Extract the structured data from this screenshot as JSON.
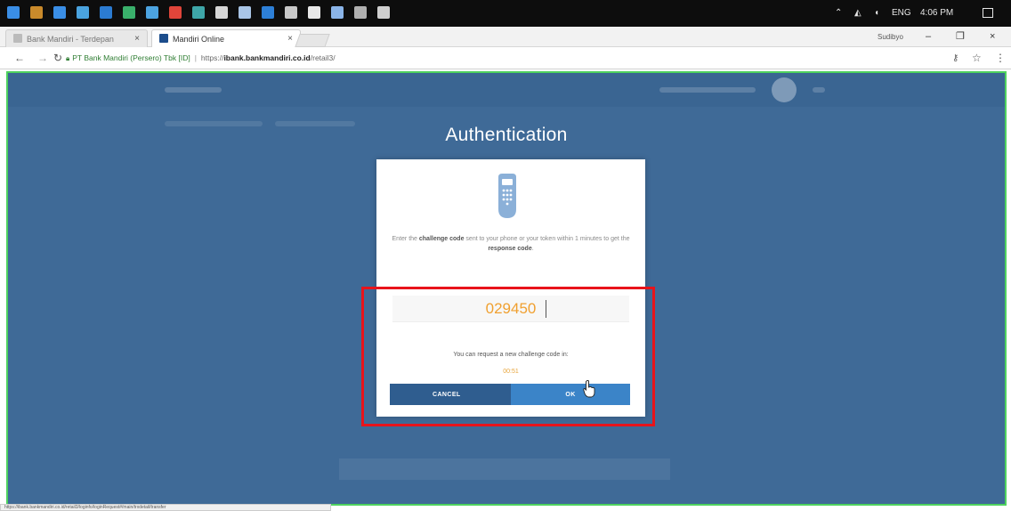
{
  "taskbar": {
    "icons": [
      {
        "name": "windows-start-icon",
        "color": "#3a8ee6"
      },
      {
        "name": "app-icon-1",
        "color": "#c98a2b"
      },
      {
        "name": "app-icon-2",
        "color": "#3a8ee6"
      },
      {
        "name": "app-icon-3",
        "color": "#4aa3df"
      },
      {
        "name": "app-icon-4",
        "color": "#2b7bd1"
      },
      {
        "name": "app-icon-5",
        "color": "#3ab06b"
      },
      {
        "name": "app-icon-6",
        "color": "#4ca3e0"
      },
      {
        "name": "chrome-icon",
        "color": "#e0453a"
      },
      {
        "name": "app-icon-8",
        "color": "#3ea6a8"
      },
      {
        "name": "app-icon-9",
        "color": "#d6d6d6"
      },
      {
        "name": "app-icon-10",
        "color": "#a9c5e6"
      },
      {
        "name": "app-icon-11",
        "color": "#2d7fd6"
      },
      {
        "name": "app-icon-12",
        "color": "#c8c8c8"
      },
      {
        "name": "app-icon-13",
        "color": "#e8e8e8"
      },
      {
        "name": "app-icon-14",
        "color": "#8ab4e8"
      },
      {
        "name": "app-icon-15",
        "color": "#b0b0b0"
      },
      {
        "name": "app-icon-16",
        "color": "#cfcfcf"
      }
    ],
    "tray_language": "ENG",
    "tray_time": "4:06 PM"
  },
  "browser": {
    "tabs": [
      {
        "label": "Bank Mandiri - Terdepan"
      },
      {
        "label": "Mandiri Online"
      }
    ],
    "profile_label": "Sudibyo",
    "address": {
      "org": "PT Bank Mandiri (Persero) Tbk [ID]",
      "scheme": "https://",
      "host": "ibank.bankmandiri.co.id",
      "path": "/retail3/"
    },
    "status_url": "https://ibank.bankmandiri.co.id/retail3/loginfo/loginRequest#/main/trxdetail/transfer"
  },
  "page": {
    "title": "Authentication",
    "description_prefix": "Enter the",
    "description_bold1": "challenge code",
    "description_mid": "sent to your phone or your token within 1 minutes to get the",
    "description_bold2": "response code",
    "description_suffix": ".",
    "code_value": "029450",
    "resend_text": "You can request a new challenge code in:",
    "timer": "00:51",
    "cancel_label": "CANCEL",
    "ok_label": "OK"
  },
  "colors": {
    "page_background": "#3f6a97",
    "accent_orange": "#f0a030",
    "cancel_button": "#2f5d8f",
    "ok_button": "#3b84c8",
    "highlight_box": "#e8141b",
    "focus_border": "#4ed15e"
  }
}
